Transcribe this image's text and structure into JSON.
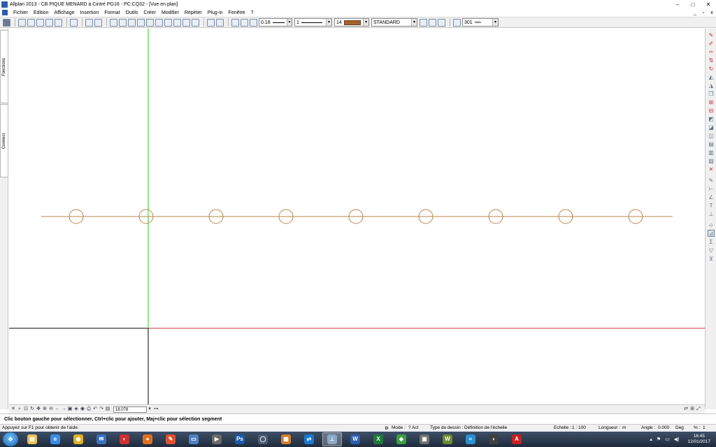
{
  "window": {
    "title": "Allplan 2013 - CB PIQUE MENARD à Cintré PG16 - PC:CQ32 - [Vue en plan]",
    "minimize": "–",
    "maximize": "□",
    "close": "✕"
  },
  "menu": {
    "items": [
      "Fichier",
      "Edition",
      "Affichage",
      "Insertion",
      "Format",
      "Outils",
      "Créer",
      "Modifier",
      "Répéter",
      "Plug-in",
      "Fenêtre",
      "?"
    ],
    "mdi_minimize": "_",
    "mdi_restore": "▫",
    "mdi_close": "x"
  },
  "toolbar": {
    "pen_thickness": "0.18",
    "line_type": "1",
    "color_number": "14",
    "layer": "STANDARD",
    "hatch_number": "301",
    "swatch_color": "#a0642c"
  },
  "left_tabs": [
    "Fonctions",
    "Connect"
  ],
  "viewport": {
    "zoom_value": "18.078",
    "construction_line_color": "#b8864a",
    "green_axis_color": "#28c828",
    "red_axis_color": "#d83030",
    "black_axis_color": "#000000",
    "circle_count": 9
  },
  "message_line": "Clic bouton gauche pour sélectionner, Ctrl+clic pour ajouter, Maj+clic pour sélection segment",
  "statusbar": {
    "help": "Appuyez sur F1 pour obtenir de l'aide.",
    "mode_label": "Mode :",
    "mode_value": "? Act",
    "drawing_type_label": "Type de dessin :",
    "drawing_type_value": "Définition de l'échelle",
    "scale_label": "Echelle :",
    "scale_value": "1 : 100",
    "length_label": "Longueur :",
    "length_value": "m",
    "angle_label": "Angle :",
    "angle_value": "0.000",
    "angle_unit": "Deg",
    "percent_label": "% :",
    "percent_value": "1"
  },
  "taskbar": {
    "time": "16:45",
    "date": "12/01/2017",
    "apps": [
      {
        "name": "explorer",
        "glyph": "▤",
        "color": "#e8c35a"
      },
      {
        "name": "ie",
        "glyph": "e",
        "color": "#3a8ee6"
      },
      {
        "name": "chrome",
        "glyph": "◉",
        "color": "#e0b020"
      },
      {
        "name": "outlook",
        "glyph": "✉",
        "color": "#3a70c0"
      },
      {
        "name": "app-red",
        "glyph": "◐",
        "color": "#d03030"
      },
      {
        "name": "firefox",
        "glyph": "●",
        "color": "#e07020"
      },
      {
        "name": "paint",
        "glyph": "✎",
        "color": "#e05030"
      },
      {
        "name": "folder",
        "glyph": "▭",
        "color": "#5080c0"
      },
      {
        "name": "media",
        "glyph": "▶",
        "color": "#6a6a6a"
      },
      {
        "name": "photoshop",
        "glyph": "Ps",
        "color": "#1a5aa8"
      },
      {
        "name": "app-ring",
        "glyph": "◯",
        "color": "#4a5a70"
      },
      {
        "name": "app-blocks",
        "glyph": "▦",
        "color": "#d08030"
      },
      {
        "name": "teamviewer",
        "glyph": "⇄",
        "color": "#1a78d0"
      },
      {
        "name": "allplan",
        "glyph": "⊥",
        "color": "#8aa8c8"
      },
      {
        "name": "word",
        "glyph": "W",
        "color": "#2b5fb0"
      },
      {
        "name": "excel",
        "glyph": "X",
        "color": "#1f7a3a"
      },
      {
        "name": "app-globe",
        "glyph": "◆",
        "color": "#3aa040"
      },
      {
        "name": "app-doc",
        "glyph": "▣",
        "color": "#707070"
      },
      {
        "name": "app-w",
        "glyph": "W",
        "color": "#6a8a30"
      },
      {
        "name": "app-wave",
        "glyph": "≈",
        "color": "#2a90d0"
      },
      {
        "name": "app-mouse",
        "glyph": "◗",
        "color": "#404040"
      },
      {
        "name": "acrobat",
        "glyph": "A",
        "color": "#c82020"
      }
    ]
  }
}
